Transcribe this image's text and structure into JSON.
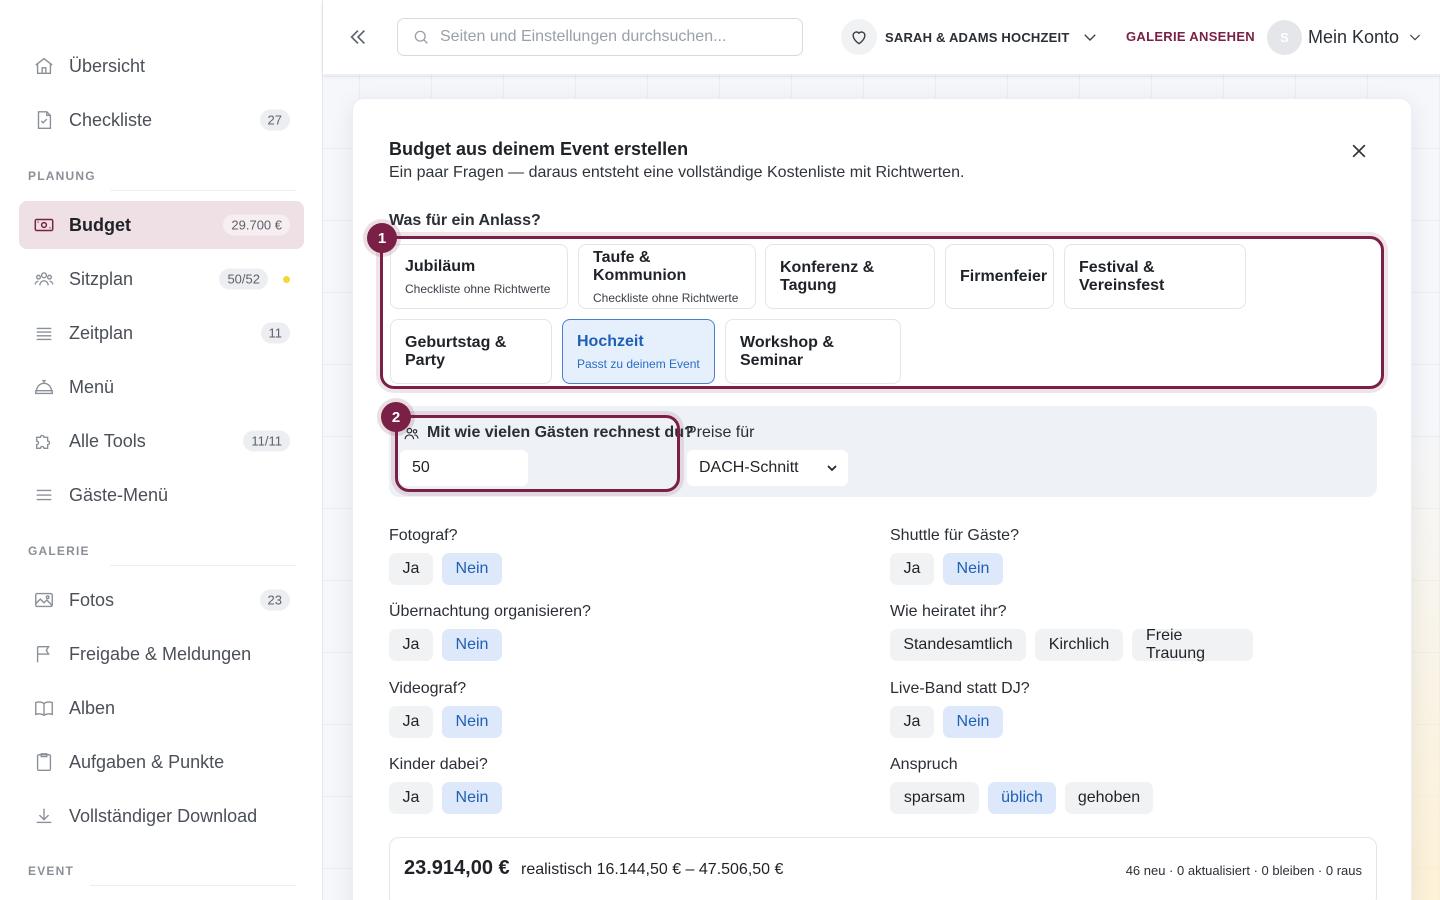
{
  "sidebar": {
    "items": [
      {
        "label": "Übersicht",
        "badge": "",
        "icon": "home-icon"
      },
      {
        "label": "Checkliste",
        "badge": "27",
        "icon": "checklist-icon"
      },
      {
        "label": "Budget",
        "badge": "29.700 €",
        "icon": "money-icon",
        "active": true
      },
      {
        "label": "Sitzplan",
        "badge": "50/52",
        "icon": "people-icon",
        "dot_color": "#f4d83a"
      },
      {
        "label": "Zeitplan",
        "badge": "11",
        "icon": "list-icon"
      },
      {
        "label": "Menü",
        "badge": "",
        "icon": "cloche-icon"
      },
      {
        "label": "Alle Tools",
        "badge": "11/11",
        "icon": "puzzle-icon"
      },
      {
        "label": "Gäste-Menü",
        "badge": "",
        "icon": "menu-icon"
      },
      {
        "label": "Fotos",
        "badge": "23",
        "icon": "image-icon"
      },
      {
        "label": "Freigabe & Meldungen",
        "badge": "",
        "icon": "flag-icon"
      },
      {
        "label": "Alben",
        "badge": "",
        "icon": "book-icon"
      },
      {
        "label": "Aufgaben & Punkte",
        "badge": "",
        "icon": "clipboard-icon"
      },
      {
        "label": "Vollständiger Download",
        "badge": "",
        "icon": "download-icon"
      }
    ],
    "sections": {
      "planung": "PLANUNG",
      "galerie": "GALERIE",
      "event": "EVENT"
    }
  },
  "header": {
    "search_placeholder": "Seiten und Einstellungen durchsuchen...",
    "event_name": "SARAH & ADAMS HOCHZEIT",
    "gallery_link": "GALERIE ANSEHEN",
    "avatar_initial": "S",
    "account_label": "Mein Konto"
  },
  "modal": {
    "title": "Budget aus deinem Event erstellen",
    "subtitle": "Ein paar Fragen — daraus entsteht eine vollständige Kostenliste mit Richtwerten.",
    "occasion_question": "Was für ein Anlass?",
    "step1": "1",
    "step2": "2",
    "occasions": [
      {
        "title": "Jubiläum",
        "sub": "Checkliste ohne Richtwerte"
      },
      {
        "title": "Taufe & Kommunion",
        "sub": "Checkliste ohne Richtwerte"
      },
      {
        "title": "Konferenz & Tagung",
        "sub": ""
      },
      {
        "title": "Firmenfeier",
        "sub": ""
      },
      {
        "title": "Festival & Vereinsfest",
        "sub": ""
      },
      {
        "title": "Geburtstag & Party",
        "sub": ""
      },
      {
        "title": "Hochzeit",
        "sub": "Passt zu deinem Event",
        "selected": true
      },
      {
        "title": "Workshop & Seminar",
        "sub": ""
      }
    ],
    "guests_question": "Mit wie vielen Gästen rechnest du?",
    "guests_value": "50",
    "price_label": "Preise für",
    "price_value": "DACH-Schnitt",
    "questions": {
      "fotograf": {
        "label": "Fotograf?",
        "options": [
          "Ja",
          "Nein"
        ],
        "selected": "Nein"
      },
      "shuttle": {
        "label": "Shuttle für Gäste?",
        "options": [
          "Ja",
          "Nein"
        ],
        "selected": "Nein"
      },
      "uebernachtung": {
        "label": "Übernachtung organisieren?",
        "options": [
          "Ja",
          "Nein"
        ],
        "selected": "Nein"
      },
      "heirat": {
        "label": "Wie heiratet ihr?",
        "options": [
          "Standesamtlich",
          "Kirchlich",
          "Freie Trauung"
        ],
        "selected": ""
      },
      "videograf": {
        "label": "Videograf?",
        "options": [
          "Ja",
          "Nein"
        ],
        "selected": "Nein"
      },
      "liveband": {
        "label": "Live-Band statt DJ?",
        "options": [
          "Ja",
          "Nein"
        ],
        "selected": "Nein"
      },
      "kinder": {
        "label": "Kinder dabei?",
        "options": [
          "Ja",
          "Nein"
        ],
        "selected": "Nein"
      },
      "anspruch": {
        "label": "Anspruch",
        "options": [
          "sparsam",
          "üblich",
          "gehoben"
        ],
        "selected": "üblich"
      }
    },
    "result": {
      "total": "23.914,00 €",
      "realistic": "realistisch 16.144,50 € – 47.506,50 €",
      "stats": "46 neu · 0 aktualisiert · 0 bleiben · 0 raus"
    }
  },
  "colors": {
    "accent": "#7a1f45",
    "selected_blue": "#1f5fb5",
    "selected_bg": "#e6f0fc"
  }
}
